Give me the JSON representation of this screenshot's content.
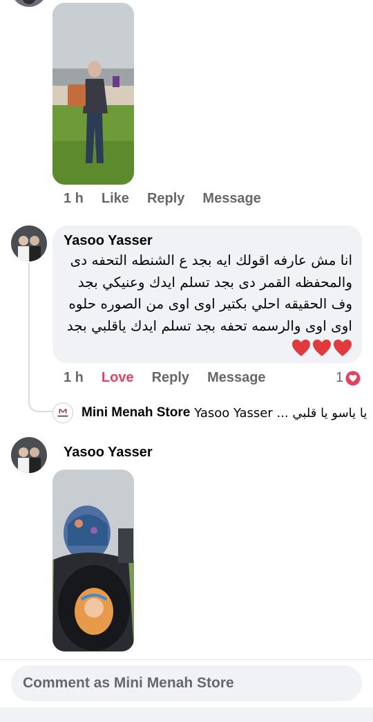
{
  "comments": [
    {
      "time": "1 h",
      "like": "Like",
      "reply": "Reply",
      "message": "Message"
    },
    {
      "author": "Yasoo Yasser",
      "lines": [
        "انا مش عارفه اقولك ايه بجد ع الشنطه التحفه دى",
        "والمحفظه القمر دى بجد تسلم ايدك وعنيكي بجد",
        "وف الحقيقه احلي بكتير اوى اوى من الصوره حلوه",
        "اوى اوى والرسمه تحفه بجد تسلم ايدك ياقلبي بجد"
      ],
      "emoji": "❤️❤️❤️",
      "time": "1 h",
      "reaction_label": "Love",
      "reply": "Reply",
      "message": "Message",
      "reaction_count": "1",
      "reply_preview": {
        "author": "Mini Menah Store",
        "text": "Yasoo Yasser ... يا ياسو يا قلبي"
      }
    },
    {
      "author": "Yasoo Yasser"
    }
  ],
  "composer": {
    "placeholder": "Comment as Mini Menah Store"
  },
  "colors": {
    "love": "#e4405f",
    "secondary_text": "#65676b",
    "bubble": "#f0f2f5"
  }
}
